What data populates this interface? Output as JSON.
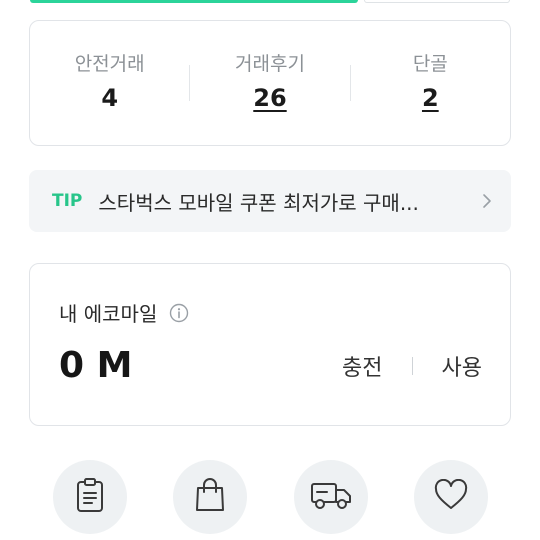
{
  "stats": [
    {
      "label": "안전거래",
      "value": "4"
    },
    {
      "label": "거래후기",
      "value": "26"
    },
    {
      "label": "단골",
      "value": "2"
    }
  ],
  "tip": {
    "tag": "TIP",
    "text": "스타벅스 모바일 쿠폰 최저가로 구매..."
  },
  "mileage": {
    "title": "내 에코마일",
    "amount": "0 M",
    "charge_label": "충전",
    "use_label": "사용"
  },
  "shortcuts": [
    {
      "icon": "clipboard-icon"
    },
    {
      "icon": "shopping-bag-icon"
    },
    {
      "icon": "delivery-truck-icon"
    },
    {
      "icon": "heart-icon"
    }
  ],
  "colors": {
    "accent_green": "#27c58a",
    "top_bar_green": "#2bd49a",
    "card_border": "#e1e4e8",
    "tip_background": "#f3f5f7",
    "icon_circle": "#eef1f3"
  }
}
